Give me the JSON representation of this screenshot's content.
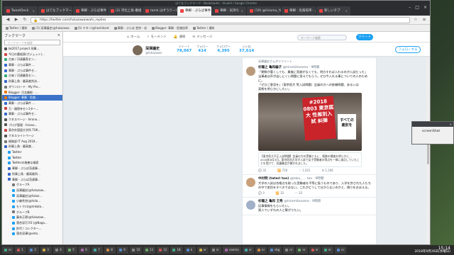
{
  "window": {
    "title": "はてなブックマーク - Bookmarks - Vivaldi / Google Chrome"
  },
  "tabs": [
    {
      "label": "TweetDeck",
      "active": false
    },
    {
      "label": "はてなブックマーク",
      "active": false
    },
    {
      "label": "華郵 - ぷらば事件",
      "active": false
    },
    {
      "label": "(2) 河北上角-番組",
      "active": false
    },
    {
      "label": "tamk はずうりー日記",
      "active": false
    },
    {
      "label": "華郵 - ぷらば事件",
      "active": true
    },
    {
      "label": "華郵 - 気持ち",
      "active": false
    },
    {
      "label": "(10) @Hiromo_Yaku",
      "active": false
    },
    {
      "label": "華郵 - 危険倍率-",
      "active": false
    },
    {
      "label": "新しいタブ",
      "active": false
    }
  ],
  "toolbar": {
    "url": "https://twitter.com/fukazawaiwahi_replies"
  },
  "bookmarks_bar": [
    "Twitter / 通知",
    "(1) 深澤議史(@fukazawa",
    "(5) ヤタン(@hoshikant",
    "華郵 - ぷらば 昔詩 - 化",
    "Blogger: 華郵 - 危険倍率",
    "Twitter / 通知"
  ],
  "sidebar": {
    "title": "ブックマーク",
    "search_placeholder": "ブックマークを検索",
    "items": [
      {
        "label": "bk2017.project 刑事...",
        "color": "#555",
        "selected": false
      },
      {
        "label": "今日の番組表(ガジェット)...",
        "color": "#c44",
        "selected": false
      },
      {
        "label": "古来 / 河清廉潔セン...",
        "color": "#3a7",
        "selected": false
      },
      {
        "label": "華郵 - ぷらば事件 ...",
        "color": "#36c",
        "selected": false
      },
      {
        "label": "華郵 - ぷらば事件セ...",
        "color": "#36c",
        "selected": false
      },
      {
        "label": "古来 / 河清廉潔セン...",
        "color": "#3a7",
        "selected": false
      },
      {
        "label": "刑事上角 - 最高裁判決...",
        "color": "#36c",
        "selected": false
      },
      {
        "label": "ダウンロード - My Pro...",
        "color": "#777",
        "selected": false
      },
      {
        "label": "Blogger: 河北鶴根 - ...",
        "color": "#e70",
        "selected": false
      },
      {
        "label": "Blogger: 華郵 - 危険...",
        "color": "#e70",
        "selected": true
      },
      {
        "label": "華郵 - ぷらば事件 ...",
        "color": "#36c",
        "selected": false
      },
      {
        "label": "万 - 福堪寺セン1ター...",
        "color": "#c44",
        "selected": false
      },
      {
        "label": "華郵 - ぷらば事件セ...",
        "color": "#36c",
        "selected": false
      },
      {
        "label": "クヌスページ - hirono...",
        "color": "#555",
        "selected": false
      },
      {
        "label": "ブログ管理 - hirono...",
        "color": "#555",
        "selected": false
      },
      {
        "label": "東京外国語大学所 TOK...",
        "color": "#c44",
        "selected": false
      },
      {
        "label": "クヌスライトページ",
        "color": "#555",
        "selected": false
      },
      {
        "label": "総務部 IT Aug 2018...",
        "color": "#777",
        "selected": false
      },
      {
        "label": "刑事上角 - 最高裁...",
        "color": "#36c",
        "selected": false
      },
      {
        "label": "Twitter",
        "color": "#1da1f2",
        "selected": false
      },
      {
        "label": "Twitter",
        "color": "#1da1f2",
        "selected": false
      },
      {
        "label": "Twitterの偽善な検索",
        "color": "#1da1f2",
        "selected": false
      },
      {
        "label": "華郵 - ぷらば茨達事...",
        "color": "#36c",
        "selected": false
      },
      {
        "label": "刑事上角 - 最高裁判...",
        "color": "#36c",
        "selected": false
      },
      {
        "label": "華郵 - ぷらば茨達事...",
        "color": "#36c",
        "selected": false
      },
      {
        "label": "グループA",
        "color": "#777",
        "selected": false
      },
      {
        "label": "深澤議史(@fukazaw...",
        "color": "#1da1f2",
        "selected": false
      },
      {
        "label": "深澤議史(@fukaz...",
        "color": "#1da1f2",
        "selected": false
      },
      {
        "label": "小森秀克(@hida...",
        "color": "#1da1f2",
        "selected": false
      },
      {
        "label": "モトクロ(@mikoto...",
        "color": "#1da1f2",
        "selected": false
      },
      {
        "label": "グループB",
        "color": "#777",
        "selected": false
      },
      {
        "label": "藤本正恵(@fukazaw...",
        "color": "#1da1f2",
        "selected": false
      },
      {
        "label": "落合深可 R3 (@Naga...",
        "color": "#1da1f2",
        "selected": false
      },
      {
        "label": "鈴代 / コレクター...",
        "color": "#1da1f2",
        "selected": false
      },
      {
        "label": "落合深澤(@seto..",
        "color": "#1da1f2",
        "selected": false
      }
    ]
  },
  "twitter": {
    "nav": [
      "ホーム",
      "モーメント",
      "通知",
      "メッセージ"
    ],
    "search_placeholder": "キーワード検索",
    "tweet_button": "ツイート",
    "profile": {
      "name": "深澤議史",
      "handle": "@fukazawa",
      "stats": [
        {
          "label": "ツイート",
          "value": "78,067"
        },
        {
          "label": "フォロー",
          "value": "414"
        },
        {
          "label": "フォロワー",
          "value": "4,395"
        },
        {
          "label": "いいね",
          "value": "37,614"
        }
      ],
      "follow_button": "フォローする"
    },
    "tweets": [
      {
        "retweet_note": "深澤議史さんがリツイート",
        "name": "杉龍之 亀和編子",
        "handle": "@hiromitosama · 9時間",
        "text": "「朝鮮が悪くしても、最後に悲劇がなくても、明方すれば入れるのが入試だった」\n当事者は声が出しにくい問題に答えてもらう。ぜひ今入れる事についての人のために。\n「ぜひご意見を」（東京医大 等入試問題）会員の方への依頼問題、あるいは\n実態を明らかにしたい」",
        "image_sign": "#2018 0803 東京医大 性差別入試 糾弾",
        "image_sign2": "すべての 差別を",
        "card_text": "【東京医大不正入試問題】会員の方の受験ともに、痕跡の捜査を明らかに…\n2018年8月3日。東京医科大学が入試で女子受験者の得点を一律に減点していたことを受けて、抗議集会が開かれました。",
        "actions": [
          "32",
          "730",
          "1,021",
          "1,166"
        ]
      },
      {
        "name": "中村明 (tateri ton)",
        "handle": "@taku_ … ton · 9時間",
        "text": "大学の入試は合格点を取った受験者を平等に扱うものであり、入学を許された人たちの中で差別をすべきではない。これがどうして分からないのかと、憤りをおぼえる。",
        "actions": [
          "3",
          "32",
          "35"
        ]
      },
      {
        "name": "杉龍之 亀和 王秀",
        "handle": "@hiromitosama · 9時間",
        "text": "記事情報をもらいたい。\n黒人でいずれの人と繋がりたい。",
        "actions": []
      }
    ]
  },
  "popup": {
    "title": "",
    "label": "screenShot"
  },
  "taskbar": {
    "items": [
      "nr",
      "1",
      "2",
      "3",
      "4",
      "5",
      "6",
      "7",
      "8",
      "9",
      "10",
      "11",
      "12",
      "18",
      "k",
      "nr",
      "nr",
      "noemo",
      "nr",
      "nr",
      "sbg",
      "nr",
      "nr",
      "nr",
      "nr",
      "nr"
    ],
    "clock_time": "15:14",
    "clock_date": "2018年9月26日(水曜日)"
  },
  "colors": {
    "twitter_blue": "#1da1f2",
    "selected": "#3b73c8"
  }
}
